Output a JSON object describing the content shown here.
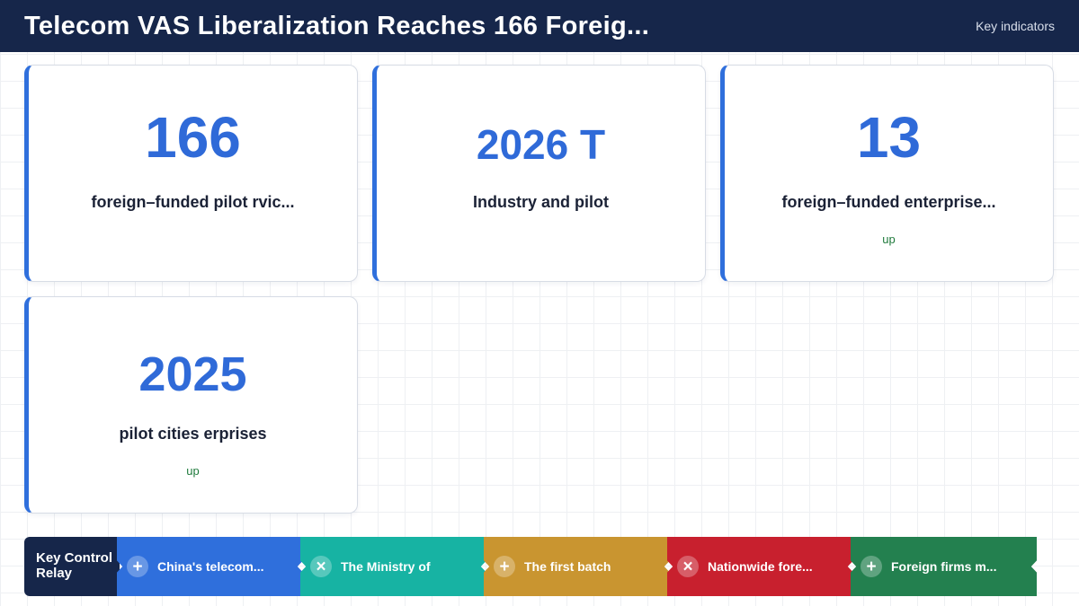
{
  "header": {
    "title": "Telecom VAS Liberalization Reaches 166 Foreig...",
    "tag": "Key indicators"
  },
  "cards": [
    {
      "value": "166",
      "label": "foreign–funded pilot rvic...",
      "trend": ""
    },
    {
      "value": "2026 T",
      "label": "Industry and pilot",
      "trend": ""
    },
    {
      "value": "13",
      "label": "foreign–funded enterprise...",
      "trend": "up"
    },
    {
      "value": "2025",
      "label": "pilot cities erprises",
      "trend": "up"
    }
  ],
  "relay": {
    "title": "Key Control Relay",
    "items": [
      {
        "icon": "+",
        "icon_name": "plus-icon",
        "text": "China's telecom...",
        "color": "#2f6fdc"
      },
      {
        "icon": "×",
        "icon_name": "close-icon",
        "text": "The Ministry of",
        "color": "#17b3a3"
      },
      {
        "icon": "+",
        "icon_name": "plus-icon",
        "text": "The first batch",
        "color": "#c99530"
      },
      {
        "icon": "×",
        "icon_name": "close-icon",
        "text": "Nationwide fore...",
        "color": "#c8202e"
      },
      {
        "icon": "+",
        "icon_name": "plus-icon",
        "text": "Foreign firms m...",
        "color": "#23804f"
      }
    ]
  },
  "colors": {
    "header_bg": "#16264a",
    "accent": "#2f6fdc",
    "trend_up": "#1f7a3c"
  }
}
